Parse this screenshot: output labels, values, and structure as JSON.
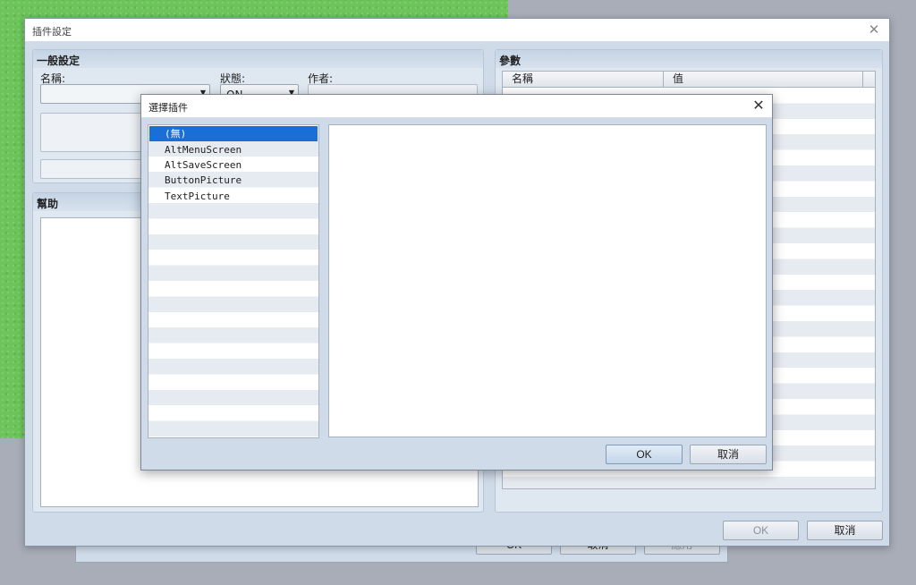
{
  "back_window": {
    "buttons": [
      "OK",
      "取消",
      "應用"
    ]
  },
  "main_window": {
    "title": "插件設定",
    "general": {
      "title": "一般設定",
      "name_label": "名稱:",
      "status_label": "狀態:",
      "status_value": "ON",
      "author_label": "作者:"
    },
    "help": {
      "title": "幫助"
    },
    "params": {
      "title": "參數",
      "columns": [
        "名稱",
        "值"
      ]
    },
    "buttons": {
      "ok": "OK",
      "cancel": "取消"
    }
  },
  "dialog": {
    "title": "選擇插件",
    "items": [
      "(無)",
      "AltMenuScreen",
      "AltSaveScreen",
      "ButtonPicture",
      "TextPicture"
    ],
    "selected_index": 0,
    "buttons": {
      "ok": "OK",
      "cancel": "取消"
    }
  },
  "icons": {
    "close": "close-icon",
    "dropdown": "chevron-down-icon"
  }
}
